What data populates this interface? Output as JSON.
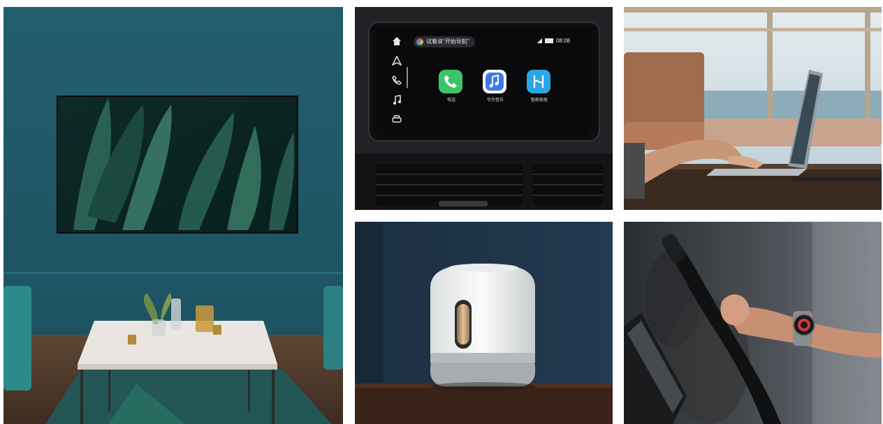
{
  "gallery": {
    "tiles": [
      {
        "scene": "living-room-tv"
      },
      {
        "scene": "car-display"
      },
      {
        "scene": "laptop-by-window"
      },
      {
        "scene": "smart-speaker"
      },
      {
        "scene": "smartwatch-workout"
      }
    ]
  },
  "car_screen": {
    "voice_hint": "试着说\"开始导航\"",
    "time": "08:08",
    "apps": [
      {
        "label": "电话",
        "icon": "phone-icon",
        "color": "#3cc46a"
      },
      {
        "label": "华为音乐",
        "icon": "music-icon",
        "color": "#3b7be8"
      },
      {
        "label": "智能家居",
        "icon": "hilink-icon",
        "color": "#2aa6e8"
      }
    ],
    "sidebar_icons": [
      "home-icon",
      "navigation-icon",
      "phone-icon",
      "music-icon",
      "car-icon"
    ]
  },
  "colors": {
    "wall": "#1f5a6a",
    "car_bg": "#1a1a1c",
    "speaker_bg": "#1e3346"
  }
}
